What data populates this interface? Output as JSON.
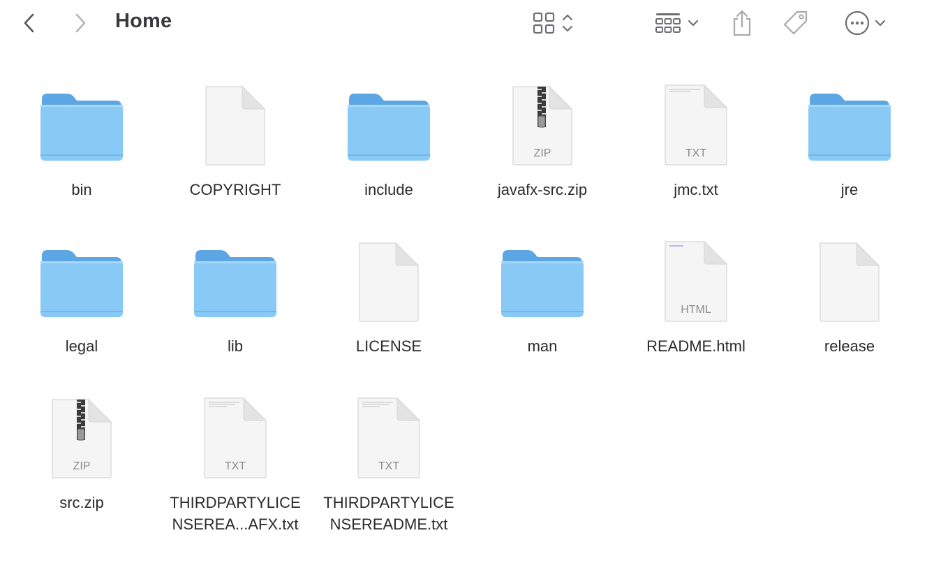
{
  "window": {
    "title": "Home"
  },
  "toolbar": {
    "back_icon": "chevron-left-icon",
    "forward_icon": "chevron-right-icon",
    "view_icon": "grid-view-icon",
    "group_icon": "group-icon",
    "share_icon": "share-icon",
    "tag_icon": "tag-icon",
    "more_icon": "ellipsis-circle-icon"
  },
  "items": [
    {
      "name": "bin",
      "kind": "folder"
    },
    {
      "name": "COPYRIGHT",
      "kind": "document"
    },
    {
      "name": "include",
      "kind": "folder"
    },
    {
      "name": "javafx-src.zip",
      "kind": "zip",
      "tag": "ZIP"
    },
    {
      "name": "jmc.txt",
      "kind": "text",
      "tag": "TXT"
    },
    {
      "name": "jre",
      "kind": "folder"
    },
    {
      "name": "legal",
      "kind": "folder"
    },
    {
      "name": "lib",
      "kind": "folder"
    },
    {
      "name": "LICENSE",
      "kind": "document"
    },
    {
      "name": "man",
      "kind": "folder"
    },
    {
      "name": "README.html",
      "kind": "html",
      "tag": "HTML"
    },
    {
      "name": "release",
      "kind": "document"
    },
    {
      "name": "src.zip",
      "kind": "zip",
      "tag": "ZIP"
    },
    {
      "name_line1": "THIRDPARTYLICE",
      "name_line2": "NSEREA...AFX.txt",
      "kind": "text",
      "tag": "TXT"
    },
    {
      "name_line1": "THIRDPARTYLICE",
      "name_line2": "NSEREADME.txt",
      "kind": "text",
      "tag": "TXT"
    }
  ],
  "colors": {
    "folder_front": "#89c9f5",
    "folder_back": "#5ba6e3",
    "doc_paper": "#f5f5f5",
    "toolbar_icon": "#6e6e73"
  }
}
